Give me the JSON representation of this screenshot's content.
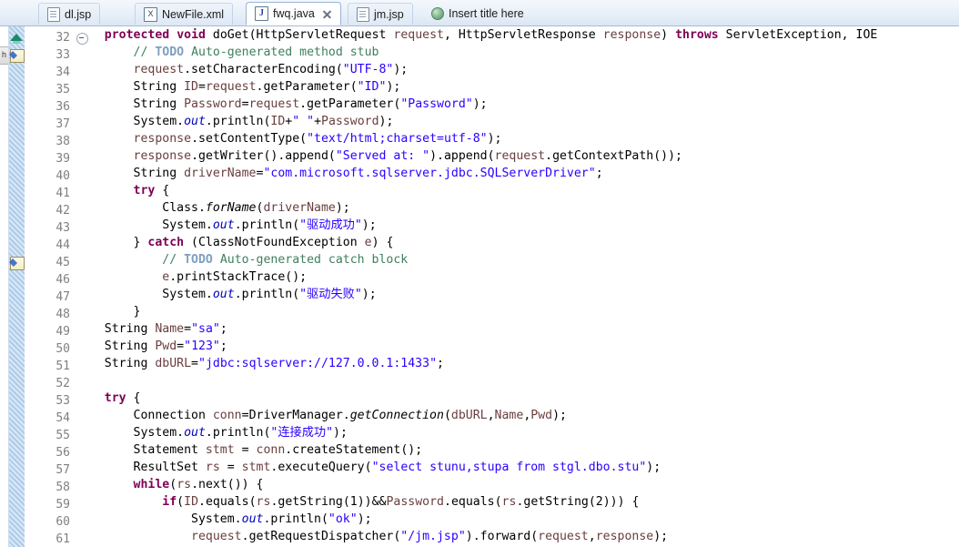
{
  "window": {
    "app": "Eclipse Java Editor",
    "left_stub_label": "h"
  },
  "tabs": [
    {
      "label": "dl.jsp",
      "icon": "jsp-file-icon",
      "state": "inactive",
      "closable": false
    },
    {
      "label": "NewFile.xml",
      "icon": "xml-file-icon",
      "state": "inactive",
      "closable": false,
      "icon_glyph": "X"
    },
    {
      "label": "fwq.java",
      "icon": "java-file-icon",
      "state": "active",
      "closable": true,
      "icon_glyph": "J"
    },
    {
      "label": "jm.jsp",
      "icon": "jsp-file-icon",
      "state": "inactive",
      "closable": false
    },
    {
      "label": "Insert title here",
      "icon": "globe-icon",
      "state": "plain",
      "closable": false
    }
  ],
  "editor": {
    "first_line": 32,
    "last_line": 61,
    "markers": [
      {
        "line": 32,
        "type": "override-arrow-marker"
      },
      {
        "line": 33,
        "type": "todo-task-marker"
      },
      {
        "line": 45,
        "type": "todo-task-marker"
      }
    ],
    "folding": [
      {
        "line": 32,
        "type": "collapse-minus"
      }
    ],
    "lines": [
      {
        "n": 32,
        "tokens": [
          {
            "t": "    ",
            "c": "pln"
          },
          {
            "t": "protected",
            "c": "kw"
          },
          {
            "t": " ",
            "c": "pln"
          },
          {
            "t": "void",
            "c": "kw"
          },
          {
            "t": " doGet(HttpServletRequest ",
            "c": "pln"
          },
          {
            "t": "request",
            "c": "par"
          },
          {
            "t": ", HttpServletResponse ",
            "c": "pln"
          },
          {
            "t": "response",
            "c": "par"
          },
          {
            "t": ") ",
            "c": "pln"
          },
          {
            "t": "throws",
            "c": "kw"
          },
          {
            "t": " ServletException, IOE",
            "c": "pln"
          }
        ]
      },
      {
        "n": 33,
        "tokens": [
          {
            "t": "        ",
            "c": "pln"
          },
          {
            "t": "// ",
            "c": "cmt"
          },
          {
            "t": "TODO",
            "c": "todo"
          },
          {
            "t": " Auto-generated method stub",
            "c": "cmt"
          }
        ]
      },
      {
        "n": 34,
        "tokens": [
          {
            "t": "        ",
            "c": "pln"
          },
          {
            "t": "request",
            "c": "par"
          },
          {
            "t": ".setCharacterEncoding(",
            "c": "pln"
          },
          {
            "t": "\"UTF-8\"",
            "c": "str"
          },
          {
            "t": ");",
            "c": "pln"
          }
        ]
      },
      {
        "n": 35,
        "tokens": [
          {
            "t": "        String ",
            "c": "pln"
          },
          {
            "t": "ID",
            "c": "loc"
          },
          {
            "t": "=",
            "c": "pln"
          },
          {
            "t": "request",
            "c": "par"
          },
          {
            "t": ".getParameter(",
            "c": "pln"
          },
          {
            "t": "\"ID\"",
            "c": "str"
          },
          {
            "t": ");",
            "c": "pln"
          }
        ]
      },
      {
        "n": 36,
        "tokens": [
          {
            "t": "        String ",
            "c": "pln"
          },
          {
            "t": "Password",
            "c": "loc"
          },
          {
            "t": "=",
            "c": "pln"
          },
          {
            "t": "request",
            "c": "par"
          },
          {
            "t": ".getParameter(",
            "c": "pln"
          },
          {
            "t": "\"Password\"",
            "c": "str"
          },
          {
            "t": ");",
            "c": "pln"
          }
        ]
      },
      {
        "n": 37,
        "tokens": [
          {
            "t": "        System.",
            "c": "pln"
          },
          {
            "t": "out",
            "c": "fld"
          },
          {
            "t": ".println(",
            "c": "pln"
          },
          {
            "t": "ID",
            "c": "loc"
          },
          {
            "t": "+",
            "c": "pln"
          },
          {
            "t": "\" \"",
            "c": "str"
          },
          {
            "t": "+",
            "c": "pln"
          },
          {
            "t": "Password",
            "c": "loc"
          },
          {
            "t": ");",
            "c": "pln"
          }
        ]
      },
      {
        "n": 38,
        "tokens": [
          {
            "t": "        ",
            "c": "pln"
          },
          {
            "t": "response",
            "c": "par"
          },
          {
            "t": ".setContentType(",
            "c": "pln"
          },
          {
            "t": "\"text/html;charset=utf-8\"",
            "c": "str"
          },
          {
            "t": ");",
            "c": "pln"
          }
        ]
      },
      {
        "n": 39,
        "tokens": [
          {
            "t": "        ",
            "c": "pln"
          },
          {
            "t": "response",
            "c": "par"
          },
          {
            "t": ".getWriter().append(",
            "c": "pln"
          },
          {
            "t": "\"Served at: \"",
            "c": "str"
          },
          {
            "t": ").append(",
            "c": "pln"
          },
          {
            "t": "request",
            "c": "par"
          },
          {
            "t": ".getContextPath());",
            "c": "pln"
          }
        ]
      },
      {
        "n": 40,
        "tokens": [
          {
            "t": "        String ",
            "c": "pln"
          },
          {
            "t": "driverName",
            "c": "loc"
          },
          {
            "t": "=",
            "c": "pln"
          },
          {
            "t": "\"com.microsoft.sqlserver.jdbc.SQLServerDriver\"",
            "c": "str"
          },
          {
            "t": ";",
            "c": "pln"
          }
        ]
      },
      {
        "n": 41,
        "tokens": [
          {
            "t": "        ",
            "c": "pln"
          },
          {
            "t": "try",
            "c": "kw"
          },
          {
            "t": " {",
            "c": "pln"
          }
        ]
      },
      {
        "n": 42,
        "tokens": [
          {
            "t": "            Class.",
            "c": "pln"
          },
          {
            "t": "forName",
            "c": "stm"
          },
          {
            "t": "(",
            "c": "pln"
          },
          {
            "t": "driverName",
            "c": "loc"
          },
          {
            "t": ");",
            "c": "pln"
          }
        ]
      },
      {
        "n": 43,
        "tokens": [
          {
            "t": "            System.",
            "c": "pln"
          },
          {
            "t": "out",
            "c": "fld"
          },
          {
            "t": ".println(",
            "c": "pln"
          },
          {
            "t": "\"驱动成功\"",
            "c": "str"
          },
          {
            "t": ");",
            "c": "pln"
          }
        ]
      },
      {
        "n": 44,
        "tokens": [
          {
            "t": "        } ",
            "c": "pln"
          },
          {
            "t": "catch",
            "c": "kw"
          },
          {
            "t": " (ClassNotFoundException ",
            "c": "pln"
          },
          {
            "t": "e",
            "c": "par"
          },
          {
            "t": ") {",
            "c": "pln"
          }
        ]
      },
      {
        "n": 45,
        "tokens": [
          {
            "t": "            ",
            "c": "pln"
          },
          {
            "t": "// ",
            "c": "cmt"
          },
          {
            "t": "TODO",
            "c": "todo"
          },
          {
            "t": " Auto-generated catch block",
            "c": "cmt"
          }
        ]
      },
      {
        "n": 46,
        "tokens": [
          {
            "t": "            ",
            "c": "pln"
          },
          {
            "t": "e",
            "c": "par"
          },
          {
            "t": ".printStackTrace();",
            "c": "pln"
          }
        ]
      },
      {
        "n": 47,
        "tokens": [
          {
            "t": "            System.",
            "c": "pln"
          },
          {
            "t": "out",
            "c": "fld"
          },
          {
            "t": ".println(",
            "c": "pln"
          },
          {
            "t": "\"驱动失败\"",
            "c": "str"
          },
          {
            "t": ");",
            "c": "pln"
          }
        ]
      },
      {
        "n": 48,
        "tokens": [
          {
            "t": "        }",
            "c": "pln"
          }
        ]
      },
      {
        "n": 49,
        "tokens": [
          {
            "t": "    String ",
            "c": "pln"
          },
          {
            "t": "Name",
            "c": "loc"
          },
          {
            "t": "=",
            "c": "pln"
          },
          {
            "t": "\"sa\"",
            "c": "str"
          },
          {
            "t": ";",
            "c": "pln"
          }
        ]
      },
      {
        "n": 50,
        "tokens": [
          {
            "t": "    String ",
            "c": "pln"
          },
          {
            "t": "Pwd",
            "c": "loc"
          },
          {
            "t": "=",
            "c": "pln"
          },
          {
            "t": "\"123\"",
            "c": "str"
          },
          {
            "t": ";",
            "c": "pln"
          }
        ]
      },
      {
        "n": 51,
        "tokens": [
          {
            "t": "    String ",
            "c": "pln"
          },
          {
            "t": "dbURL",
            "c": "loc"
          },
          {
            "t": "=",
            "c": "pln"
          },
          {
            "t": "\"jdbc:sqlserver://127.0.0.1:1433\"",
            "c": "str"
          },
          {
            "t": ";",
            "c": "pln"
          }
        ]
      },
      {
        "n": 52,
        "tokens": [
          {
            "t": "",
            "c": "pln"
          }
        ]
      },
      {
        "n": 53,
        "tokens": [
          {
            "t": "    ",
            "c": "pln"
          },
          {
            "t": "try",
            "c": "kw"
          },
          {
            "t": " {",
            "c": "pln"
          }
        ]
      },
      {
        "n": 54,
        "tokens": [
          {
            "t": "        Connection ",
            "c": "pln"
          },
          {
            "t": "conn",
            "c": "loc"
          },
          {
            "t": "=DriverManager.",
            "c": "pln"
          },
          {
            "t": "getConnection",
            "c": "stm"
          },
          {
            "t": "(",
            "c": "pln"
          },
          {
            "t": "dbURL",
            "c": "loc"
          },
          {
            "t": ",",
            "c": "pln"
          },
          {
            "t": "Name",
            "c": "loc"
          },
          {
            "t": ",",
            "c": "pln"
          },
          {
            "t": "Pwd",
            "c": "loc"
          },
          {
            "t": ");",
            "c": "pln"
          }
        ]
      },
      {
        "n": 55,
        "tokens": [
          {
            "t": "        System.",
            "c": "pln"
          },
          {
            "t": "out",
            "c": "fld"
          },
          {
            "t": ".println(",
            "c": "pln"
          },
          {
            "t": "\"连接成功\"",
            "c": "str"
          },
          {
            "t": ");",
            "c": "pln"
          }
        ]
      },
      {
        "n": 56,
        "tokens": [
          {
            "t": "        Statement ",
            "c": "pln"
          },
          {
            "t": "stmt",
            "c": "loc"
          },
          {
            "t": " = ",
            "c": "pln"
          },
          {
            "t": "conn",
            "c": "loc"
          },
          {
            "t": ".createStatement();",
            "c": "pln"
          }
        ]
      },
      {
        "n": 57,
        "tokens": [
          {
            "t": "        ResultSet ",
            "c": "pln"
          },
          {
            "t": "rs",
            "c": "loc"
          },
          {
            "t": " = ",
            "c": "pln"
          },
          {
            "t": "stmt",
            "c": "loc"
          },
          {
            "t": ".executeQuery(",
            "c": "pln"
          },
          {
            "t": "\"select stunu,stupa from stgl.dbo.stu\"",
            "c": "str"
          },
          {
            "t": ");",
            "c": "pln"
          }
        ]
      },
      {
        "n": 58,
        "tokens": [
          {
            "t": "        ",
            "c": "pln"
          },
          {
            "t": "while",
            "c": "kw"
          },
          {
            "t": "(",
            "c": "pln"
          },
          {
            "t": "rs",
            "c": "loc"
          },
          {
            "t": ".next()) {",
            "c": "pln"
          }
        ]
      },
      {
        "n": 59,
        "tokens": [
          {
            "t": "            ",
            "c": "pln"
          },
          {
            "t": "if",
            "c": "kw"
          },
          {
            "t": "(",
            "c": "pln"
          },
          {
            "t": "ID",
            "c": "loc"
          },
          {
            "t": ".equals(",
            "c": "pln"
          },
          {
            "t": "rs",
            "c": "loc"
          },
          {
            "t": ".getString(1))&&",
            "c": "pln"
          },
          {
            "t": "Password",
            "c": "loc"
          },
          {
            "t": ".equals(",
            "c": "pln"
          },
          {
            "t": "rs",
            "c": "loc"
          },
          {
            "t": ".getString(2))) {",
            "c": "pln"
          }
        ]
      },
      {
        "n": 60,
        "tokens": [
          {
            "t": "                System.",
            "c": "pln"
          },
          {
            "t": "out",
            "c": "fld"
          },
          {
            "t": ".println(",
            "c": "pln"
          },
          {
            "t": "\"ok\"",
            "c": "str"
          },
          {
            "t": ");",
            "c": "pln"
          }
        ]
      },
      {
        "n": 61,
        "tokens": [
          {
            "t": "                ",
            "c": "pln"
          },
          {
            "t": "request",
            "c": "par"
          },
          {
            "t": ".getRequestDispatcher(",
            "c": "pln"
          },
          {
            "t": "\"/jm.jsp\"",
            "c": "str"
          },
          {
            "t": ").forward(",
            "c": "pln"
          },
          {
            "t": "request",
            "c": "par"
          },
          {
            "t": ",",
            "c": "pln"
          },
          {
            "t": "response",
            "c": "par"
          },
          {
            "t": ");",
            "c": "pln"
          }
        ]
      }
    ]
  },
  "colors": {
    "keyword": "#7f0055",
    "string": "#2a00ff",
    "comment": "#3f7f5f",
    "todo_tag": "#7f9fbf",
    "parameter": "#6a3e3e",
    "static_field": "#0000c0",
    "line_number": "#808080",
    "tab_active_bg": "#ffffff",
    "tabbar_bg": "#e8eff8"
  }
}
